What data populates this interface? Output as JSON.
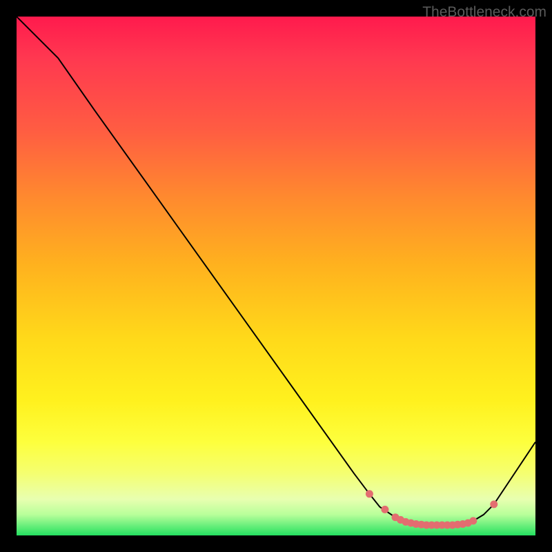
{
  "watermark": "TheBottleneck.com",
  "chart_data": {
    "type": "line",
    "title": "",
    "xlabel": "",
    "ylabel": "",
    "xlim": [
      0,
      100
    ],
    "ylim": [
      0,
      100
    ],
    "series": [
      {
        "name": "bottleneck-curve",
        "x": [
          0,
          8,
          15,
          25,
          35,
          45,
          55,
          65,
          68,
          70,
          73,
          75,
          78,
          80,
          82,
          84,
          86,
          88,
          90,
          92,
          100
        ],
        "y": [
          100,
          92,
          82,
          68,
          54,
          40,
          26,
          12,
          8,
          5.5,
          3.5,
          2.5,
          2,
          2,
          2,
          2,
          2.2,
          2.8,
          4,
          6,
          18
        ]
      }
    ],
    "markers": {
      "name": "highlight-points",
      "color": "#e36d70",
      "x": [
        68,
        71,
        73,
        74,
        75,
        76,
        77,
        78,
        79,
        80,
        81,
        82,
        83,
        84,
        85,
        86,
        87,
        88,
        92
      ],
      "y": [
        8,
        5,
        3.5,
        3,
        2.6,
        2.4,
        2.2,
        2.1,
        2,
        2,
        2,
        2,
        2,
        2,
        2.1,
        2.2,
        2.4,
        2.8,
        6
      ]
    },
    "background_gradient": {
      "top": "#ff1a4d",
      "bottom": "#24e060"
    }
  }
}
